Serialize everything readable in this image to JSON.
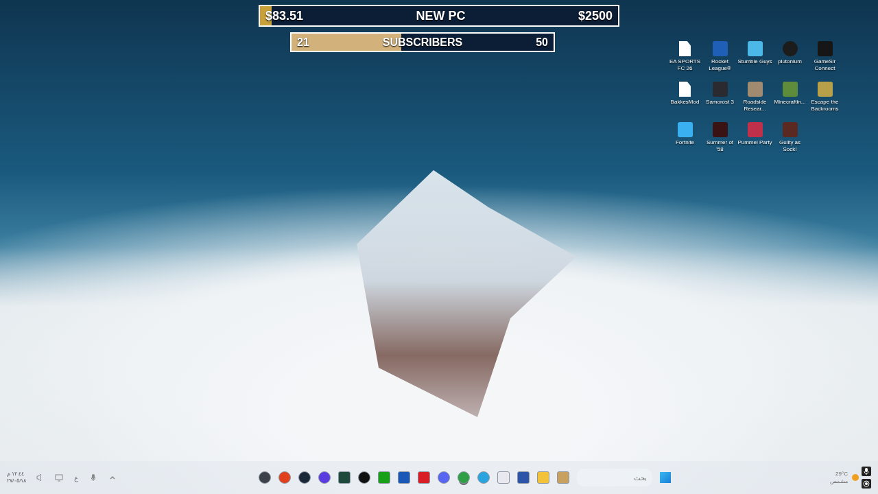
{
  "goals": [
    {
      "current": "$83.51",
      "label": "NEW PC",
      "target": "$2500",
      "level": 0.033
    },
    {
      "current": "21",
      "label": "SUBSCRIBERS",
      "target": "50",
      "level": 0.42
    }
  ],
  "desktop_icons": [
    {
      "label": "EA SPORTS FC 26",
      "kind": "file",
      "color": "#ffffff"
    },
    {
      "label": "Rocket League®",
      "kind": "tile",
      "color": "#1f5fb8"
    },
    {
      "label": "Stumble Guys",
      "kind": "tile",
      "color": "#4cb8e8"
    },
    {
      "label": "plutonium",
      "kind": "round",
      "color": "#1c1c1c"
    },
    {
      "label": "GameSir Connect",
      "kind": "tile",
      "color": "#161616"
    },
    {
      "label": "BakkesMod",
      "kind": "file",
      "color": "#ffffff"
    },
    {
      "label": "Samorost 3",
      "kind": "tile",
      "color": "#2a2a30"
    },
    {
      "label": "Roadside Resear...",
      "kind": "tile",
      "color": "#a08a70"
    },
    {
      "label": "Minecraftin...",
      "kind": "tile",
      "color": "#5f8c3a"
    },
    {
      "label": "Escape the Backrooms",
      "kind": "tile",
      "color": "#b8a04a"
    },
    {
      "label": "Fortnite",
      "kind": "tile",
      "color": "#3ab0f0"
    },
    {
      "label": "Summer of '58",
      "kind": "tile",
      "color": "#3a1414"
    },
    {
      "label": "Pummel Party",
      "kind": "tile",
      "color": "#c0304a"
    },
    {
      "label": "Guilty as Sock!",
      "kind": "tile",
      "color": "#5a2a22"
    }
  ],
  "taskbar": {
    "clock": {
      "time": "١٢:٤٤ م",
      "date": "٢٧/٠٥/١٨"
    },
    "keyboard": "ع",
    "apps": [
      {
        "kind": "round",
        "color": "#3c4048",
        "selected": false
      },
      {
        "kind": "round",
        "color": "#e0401c",
        "selected": false
      },
      {
        "kind": "round",
        "color": "#1b2838",
        "selected": false
      },
      {
        "kind": "round",
        "color": "#5a3ce0",
        "selected": false
      },
      {
        "kind": "square",
        "color": "#1e4a3e",
        "selected": false
      },
      {
        "kind": "round",
        "color": "#111111",
        "selected": false
      },
      {
        "kind": "square",
        "color": "#18a018",
        "selected": false
      },
      {
        "kind": "square",
        "color": "#1a58b8",
        "selected": false
      },
      {
        "kind": "square",
        "color": "#d81f26",
        "selected": false
      },
      {
        "kind": "round",
        "color": "#5865f2",
        "selected": false
      },
      {
        "kind": "round",
        "color": "#2f9e44",
        "selected": true
      },
      {
        "kind": "round",
        "color": "#2aa3de",
        "selected": false
      },
      {
        "kind": "square",
        "color": "#e8e8ee",
        "selected": false
      },
      {
        "kind": "square",
        "color": "#2c54a8",
        "selected": false
      },
      {
        "kind": "square",
        "color": "#f2c23a",
        "selected": false
      },
      {
        "kind": "square",
        "color": "#c8a060",
        "selected": false
      }
    ],
    "search": {
      "placeholder": "بحث"
    },
    "weather": {
      "temperature": "29°C",
      "condition": "مشمس"
    }
  }
}
